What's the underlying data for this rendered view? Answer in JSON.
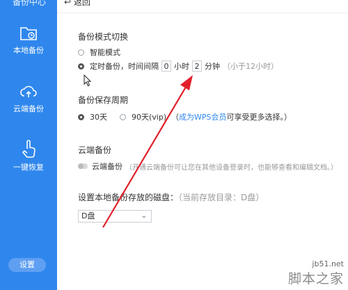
{
  "sidebar": {
    "top_text": "备份中心",
    "items": [
      {
        "label": "本地备份",
        "icon": "folder-clock-icon"
      },
      {
        "label": "云端备份",
        "icon": "cloud-upload-icon"
      },
      {
        "label": "一键恢复",
        "icon": "hand-pointer-icon"
      }
    ],
    "settings_label": "设置"
  },
  "topbar": {
    "back_label": "返回"
  },
  "mode": {
    "title": "备份模式切换",
    "option_smart": "智能模式",
    "option_timed_prefix": "定时备份，时间间隔",
    "hours_value": "0",
    "hours_unit": "小时",
    "minutes_value": "2",
    "minutes_unit": "分钟",
    "hint": "（小于12小时）"
  },
  "retention": {
    "title": "备份保存周期",
    "option_30": "30天",
    "option_90": "90天(vip)",
    "link_prefix": "（",
    "link_text": "成为WPS会员",
    "link_suffix": " 可享受更多选择。）"
  },
  "cloud": {
    "title": "云端备份",
    "toggle_label": "云端备份",
    "description": "（开通云端备份可让您在其他设备登录时，也能够查看和编辑文档。）"
  },
  "disk": {
    "title": "设置本地备份存放的磁盘：",
    "current": "（当前存放目录：D盘）",
    "selected": "D盘"
  },
  "watermark": {
    "site": "jb51.net",
    "name": "脚本之家"
  },
  "colors": {
    "sidebar": "#2f87ed",
    "arrow": "#e0202a",
    "link": "#2f87ed"
  }
}
